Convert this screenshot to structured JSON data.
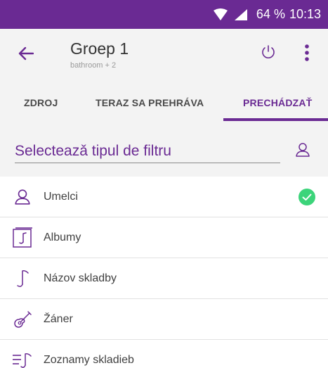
{
  "status_bar": {
    "battery": "64 %",
    "time": "10:13"
  },
  "header": {
    "title": "Groep 1",
    "subtitle": "bathroom + 2"
  },
  "tabs": [
    {
      "label": "ZDROJ"
    },
    {
      "label": "TERAZ SA PREHRÁVA"
    },
    {
      "label": "PRECHÁDZAŤ"
    }
  ],
  "filter": {
    "placeholder": "Selecteazǎ tipul de filtru"
  },
  "list": [
    {
      "label": "Umelci",
      "icon": "person-icon",
      "selected": true
    },
    {
      "label": "Albumy",
      "icon": "album-icon"
    },
    {
      "label": "Názov skladby",
      "icon": "music-note-icon"
    },
    {
      "label": "Žáner",
      "icon": "guitar-icon"
    },
    {
      "label": "Zoznamy skladieb",
      "icon": "playlist-icon"
    }
  ],
  "colors": {
    "accent": "#6a2a93",
    "check": "#3cd47a",
    "panel": "#f3f3f3"
  }
}
